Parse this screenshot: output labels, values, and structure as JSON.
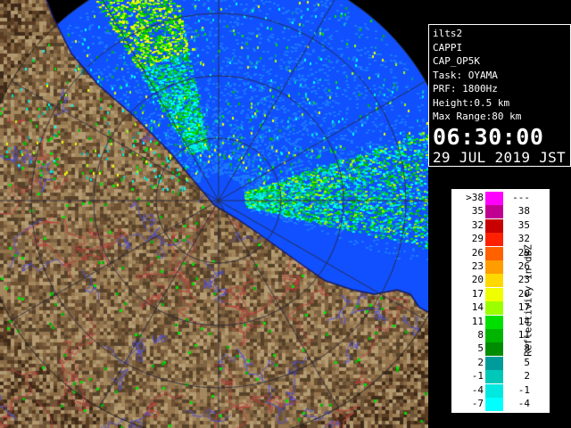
{
  "info": {
    "lines": [
      "ilts2",
      "CAPPI",
      "CAP_OP5K",
      "Task: OYAMA",
      "PRF: 1800Hz",
      "Height:0.5 km",
      "Max Range:80 km"
    ],
    "time": "06:30:00",
    "date": "29 JUL 2019 JST"
  },
  "legend": {
    "unit_label": "Reflectivity in dBZ",
    "bins": [
      {
        "lo": ">38",
        "hi": "---",
        "color": "#ff00ff"
      },
      {
        "lo": "35",
        "hi": "38",
        "color": "#c00090"
      },
      {
        "lo": "32",
        "hi": "35",
        "color": "#c80000"
      },
      {
        "lo": "29",
        "hi": "32",
        "color": "#ff2000"
      },
      {
        "lo": "26",
        "hi": "29",
        "color": "#ff6000"
      },
      {
        "lo": "23",
        "hi": "26",
        "color": "#ff9c00"
      },
      {
        "lo": "20",
        "hi": "23",
        "color": "#ffd800"
      },
      {
        "lo": "17",
        "hi": "20",
        "color": "#f0ff00"
      },
      {
        "lo": "14",
        "hi": "17",
        "color": "#9cff00"
      },
      {
        "lo": "11",
        "hi": "14",
        "color": "#00e000"
      },
      {
        "lo": "8",
        "hi": "11",
        "color": "#00b400"
      },
      {
        "lo": "5",
        "hi": "8",
        "color": "#008c00"
      },
      {
        "lo": "2",
        "hi": "5",
        "color": "#009c9c"
      },
      {
        "lo": "-1",
        "hi": "2",
        "color": "#00c8b8"
      },
      {
        "lo": "-4",
        "hi": "-1",
        "color": "#00e8e0"
      },
      {
        "lo": "-7",
        "hi": "-4",
        "color": "#00ffff"
      }
    ]
  },
  "colors": {
    "sea": "#1050ff",
    "sea_scan": "#1a78ff",
    "land": "#7a5a3a",
    "rivers": "#5050d0",
    "borders": "#c04040"
  }
}
